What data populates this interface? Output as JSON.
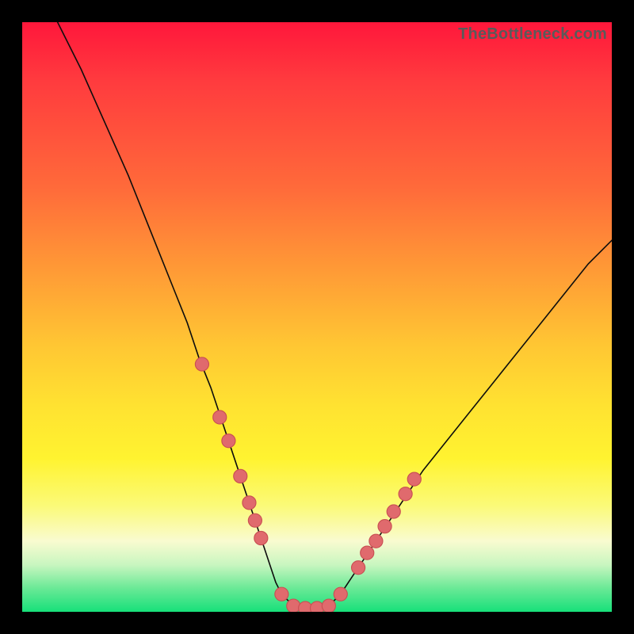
{
  "watermark": "TheBottleneck.com",
  "colors": {
    "frame": "#000000",
    "gradient_top": "#ff173b",
    "gradient_bottom": "#17e07a",
    "curve": "#0d0d0d",
    "marker_fill": "#e06a6d",
    "marker_stroke": "#c94f52"
  },
  "chart_data": {
    "type": "line",
    "title": "",
    "xlabel": "",
    "ylabel": "",
    "xlim": [
      0,
      100
    ],
    "ylim": [
      0,
      100
    ],
    "grid": false,
    "legend": false,
    "series": [
      {
        "name": "bottleneck-curve",
        "x": [
          6,
          10,
          14,
          18,
          22,
          26,
          28,
          30,
          32,
          34,
          36,
          38,
          40,
          41,
          42,
          43,
          44,
          46,
          48,
          50,
          52,
          54,
          56,
          58,
          60,
          64,
          68,
          72,
          76,
          80,
          84,
          88,
          92,
          96,
          100
        ],
        "y": [
          100,
          92,
          83,
          74,
          64,
          54,
          49,
          43,
          38,
          32,
          26,
          20,
          14,
          11,
          8,
          5,
          3,
          1,
          0.5,
          0.5,
          1,
          3,
          6,
          9,
          12,
          18,
          24,
          29,
          34,
          39,
          44,
          49,
          54,
          59,
          63
        ]
      }
    ],
    "markers": {
      "name": "highlight-points",
      "x": [
        30.5,
        33.5,
        35,
        37,
        38.5,
        39.5,
        40.5,
        44,
        46,
        48,
        50,
        52,
        54,
        57,
        58.5,
        60,
        61.5,
        63,
        65,
        66.5
      ],
      "y": [
        42,
        33,
        29,
        23,
        18.5,
        15.5,
        12.5,
        3,
        1,
        0.6,
        0.6,
        1,
        3,
        7.5,
        10,
        12,
        14.5,
        17,
        20,
        22.5
      ]
    }
  }
}
